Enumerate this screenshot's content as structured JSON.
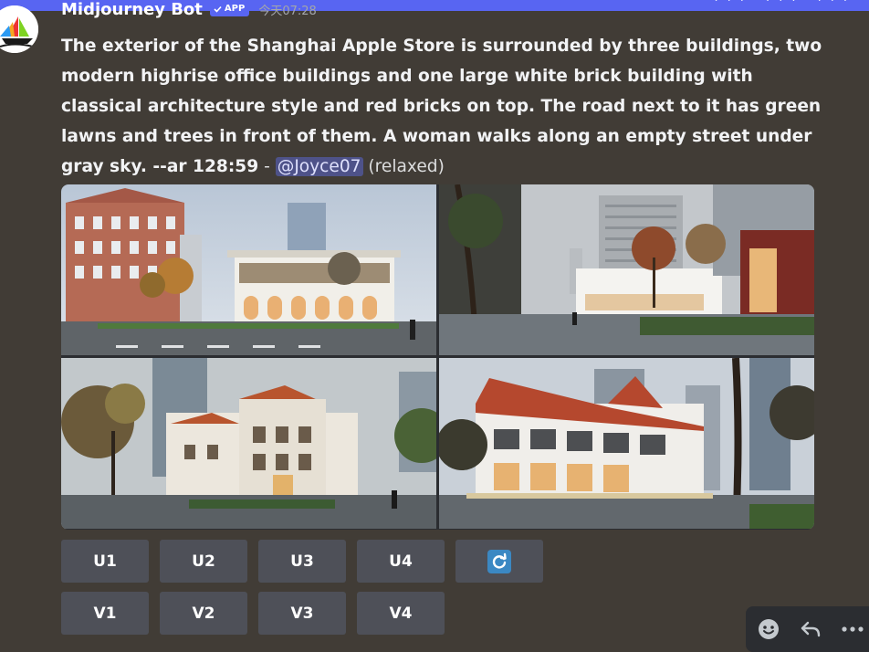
{
  "message": {
    "author": "Midjourney Bot",
    "app_badge": "APP",
    "timestamp": "今天07:28",
    "prompt": "The exterior of the Shanghai Apple Store is surrounded by three buildings, two modern highrise office buildings and one large white brick building with classical architecture style and red bricks on top. The road next to it has green lawns and trees in front of them. A woman walks along an empty street under gray sky. --ar 128:59",
    "separator": " - ",
    "mention": "@Joyce07",
    "status": " (relaxed)"
  },
  "image_grid": {
    "tiles": [
      {
        "icon": "generated-image-1"
      },
      {
        "icon": "generated-image-2"
      },
      {
        "icon": "generated-image-3"
      },
      {
        "icon": "generated-image-4"
      }
    ]
  },
  "buttons": {
    "upscale": [
      "U1",
      "U2",
      "U3",
      "U4"
    ],
    "variation": [
      "V1",
      "V2",
      "V3",
      "V4"
    ],
    "reroll_icon": "reroll-icon"
  },
  "toolbar": {
    "icons": [
      "emoji-reaction-icon",
      "reply-icon",
      "more-options-icon"
    ]
  },
  "colors": {
    "background": "#413c36",
    "accent": "#5865f2",
    "button": "#4e5058",
    "mention_bg": "#4e5289",
    "reroll": "#3b88c3"
  }
}
